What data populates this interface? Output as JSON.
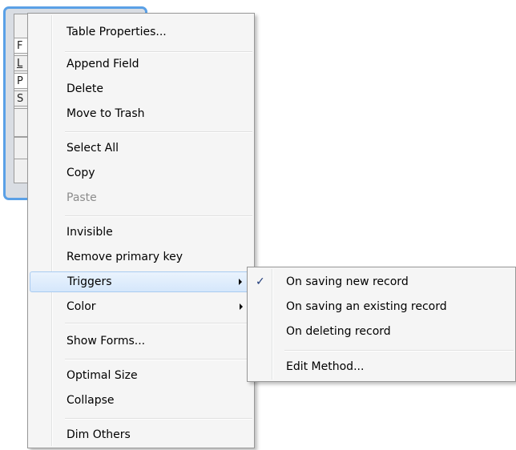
{
  "table_window": {
    "fields": [
      "F",
      "L",
      "P",
      "S"
    ]
  },
  "context_menu": {
    "items": [
      {
        "label": "Table Properties..."
      },
      {
        "label": "Append Field"
      },
      {
        "label": "Delete"
      },
      {
        "label": "Move to Trash"
      },
      {
        "label": "Select All"
      },
      {
        "label": "Copy"
      },
      {
        "label": "Paste",
        "disabled": true
      },
      {
        "label": "Invisible"
      },
      {
        "label": "Remove primary key"
      },
      {
        "label": "Triggers",
        "submenu": true,
        "highlighted": true
      },
      {
        "label": "Color",
        "submenu": true
      },
      {
        "label": "Show Forms..."
      },
      {
        "label": "Optimal Size"
      },
      {
        "label": "Collapse"
      },
      {
        "label": "Dim Others"
      }
    ]
  },
  "triggers_submenu": {
    "items": [
      {
        "label": "On saving new record",
        "checked": true
      },
      {
        "label": "On saving an existing record"
      },
      {
        "label": "On deleting record"
      },
      {
        "label": "Edit Method..."
      }
    ],
    "check_glyph": "✓"
  },
  "colors": {
    "window_border": "#5aa0e6",
    "menu_bg": "#f5f5f5",
    "highlight_border": "#a9cbf1"
  }
}
